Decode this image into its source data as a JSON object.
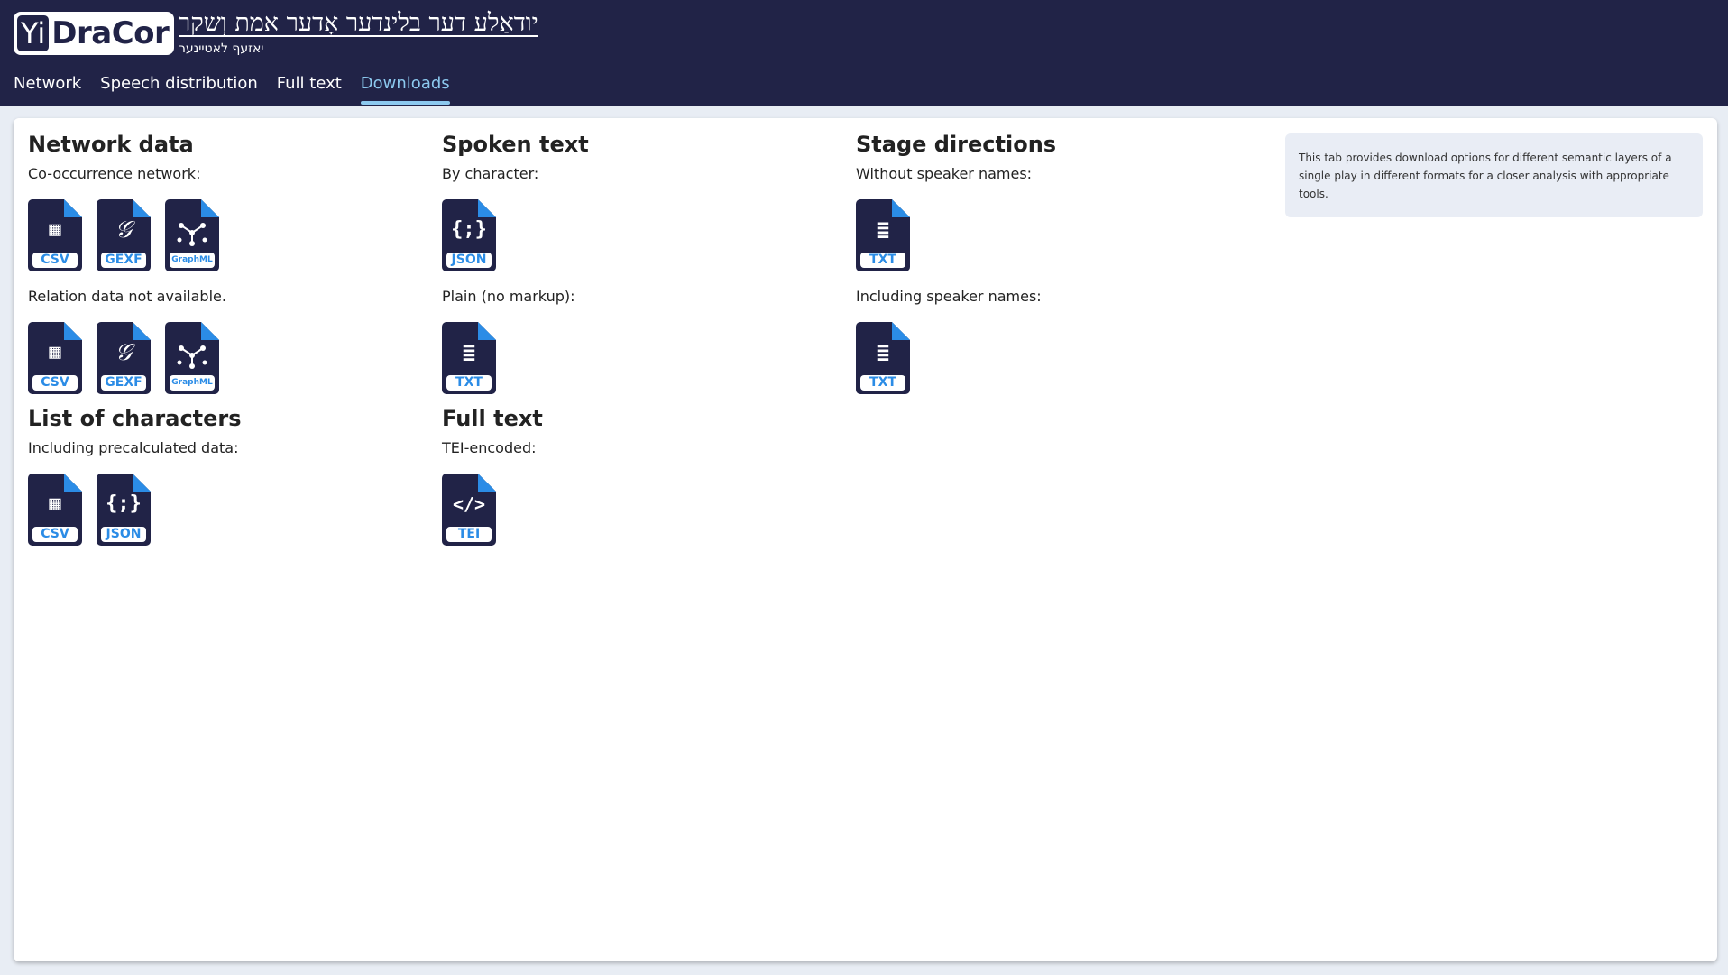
{
  "app": {
    "logo_yi": "Yi",
    "logo_name": "DraCor",
    "play_title": "יודאַלע דער בלינדער אָדער אמת וְשקר",
    "play_author": "יאזעף לאטיינער"
  },
  "tabs": [
    {
      "label": "Network"
    },
    {
      "label": "Speech distribution"
    },
    {
      "label": "Full text"
    },
    {
      "label": "Downloads"
    }
  ],
  "sections": {
    "network": {
      "title": "Network data",
      "cooc_label": "Co-occurrence network:",
      "relation_label": "Relation data not available.",
      "formats": [
        "CSV",
        "GEXF",
        "GraphML"
      ]
    },
    "characters": {
      "title": "List of characters",
      "label": "Including precalculated data:",
      "formats": [
        "CSV",
        "JSON"
      ]
    },
    "spoken": {
      "title": "Spoken text",
      "by_char_label": "By character:",
      "plain_label": "Plain (no markup):",
      "formats": [
        "JSON",
        "TXT"
      ]
    },
    "fulltext": {
      "title": "Full text",
      "label": "TEI-encoded:",
      "formats": [
        "TEI"
      ]
    },
    "stage": {
      "title": "Stage directions",
      "without_label": "Without speaker names:",
      "including_label": "Including speaker names:",
      "formats": [
        "TXT",
        "TXT"
      ]
    }
  },
  "info_text": "This tab provides download options for different semantic layers of a single play in different formats for a closer analysis with appropriate tools.",
  "colors": {
    "header_bg": "#212347",
    "accent": "#2b8ce6",
    "active_tab": "#8cc9ef"
  },
  "icons": {
    "csv": "table-glyph",
    "gexf": "gephi-glyph",
    "graphml": "graph-nodes-glyph",
    "json": "braces-glyph",
    "txt": "text-lines-glyph",
    "tei": "code-tag-glyph"
  }
}
